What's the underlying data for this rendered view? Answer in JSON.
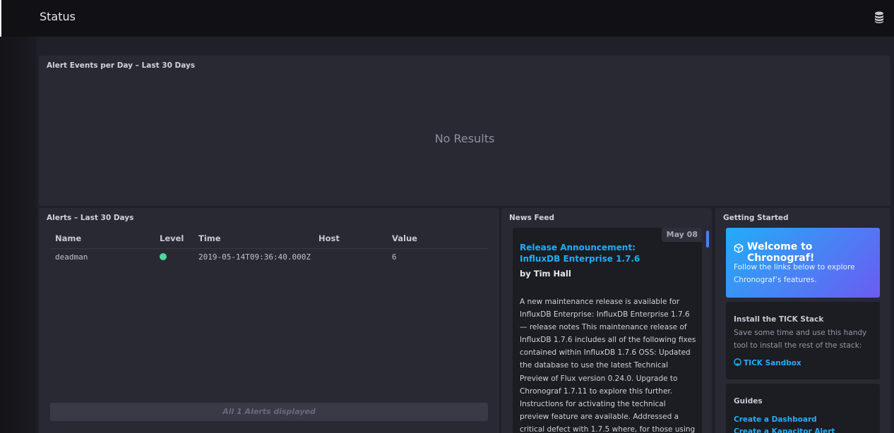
{
  "header": {
    "title": "Status",
    "icon": "database-icon"
  },
  "alert_events_panel": {
    "title": "Alert Events per Day – Last 30 Days",
    "empty_text": "No Results"
  },
  "alerts_panel": {
    "title": "Alerts – Last 30 Days",
    "columns": [
      "Name",
      "Level",
      "Time",
      "Host",
      "Value"
    ],
    "rows": [
      {
        "name": "deadman",
        "level_color": "#4ed8a0",
        "time": "2019-05-14T09:36:40.000Z",
        "host": "",
        "value": "6"
      }
    ],
    "footer": "All 1 Alerts displayed"
  },
  "news_feed": {
    "title": "News Feed",
    "date": "May 08",
    "headline": "Release Announcement: InfluxDB Enterprise 1.7.6",
    "author": "by Tim Hall",
    "body": "A new maintenance release is available for InfluxDB Enterprise: InfluxDB Enterprise 1.7.6 — release notes This maintenance release of InfluxDB 1.7.6 includes all of the following fixes contained within InfluxDB 1.7.6 OSS: Updated the database to use the latest Technical Preview of Flux version 0.24.0. Upgrade to Chronograf 1.7.11 to explore this further. Instructions for activating the technical preview feature are available. Addressed a critical defect with 1.7.5 where, for those using the"
  },
  "getting_started": {
    "title": "Getting Started",
    "welcome_title": "Welcome to Chronograf!",
    "welcome_text": "Follow the links below to explore Chronograf’s features.",
    "tick_heading": "Install the TICK Stack",
    "tick_text": "Save some time and use this handy tool to install the rest of the stack:",
    "tick_link": "TICK Sandbox",
    "guides_heading": "Guides",
    "guides_links": [
      "Create a Dashboard",
      "Create a Kapacitor Alert"
    ]
  },
  "colors": {
    "accent": "#22adf6",
    "gradient_end": "#6b5cf2",
    "ok": "#4ed8a0"
  }
}
